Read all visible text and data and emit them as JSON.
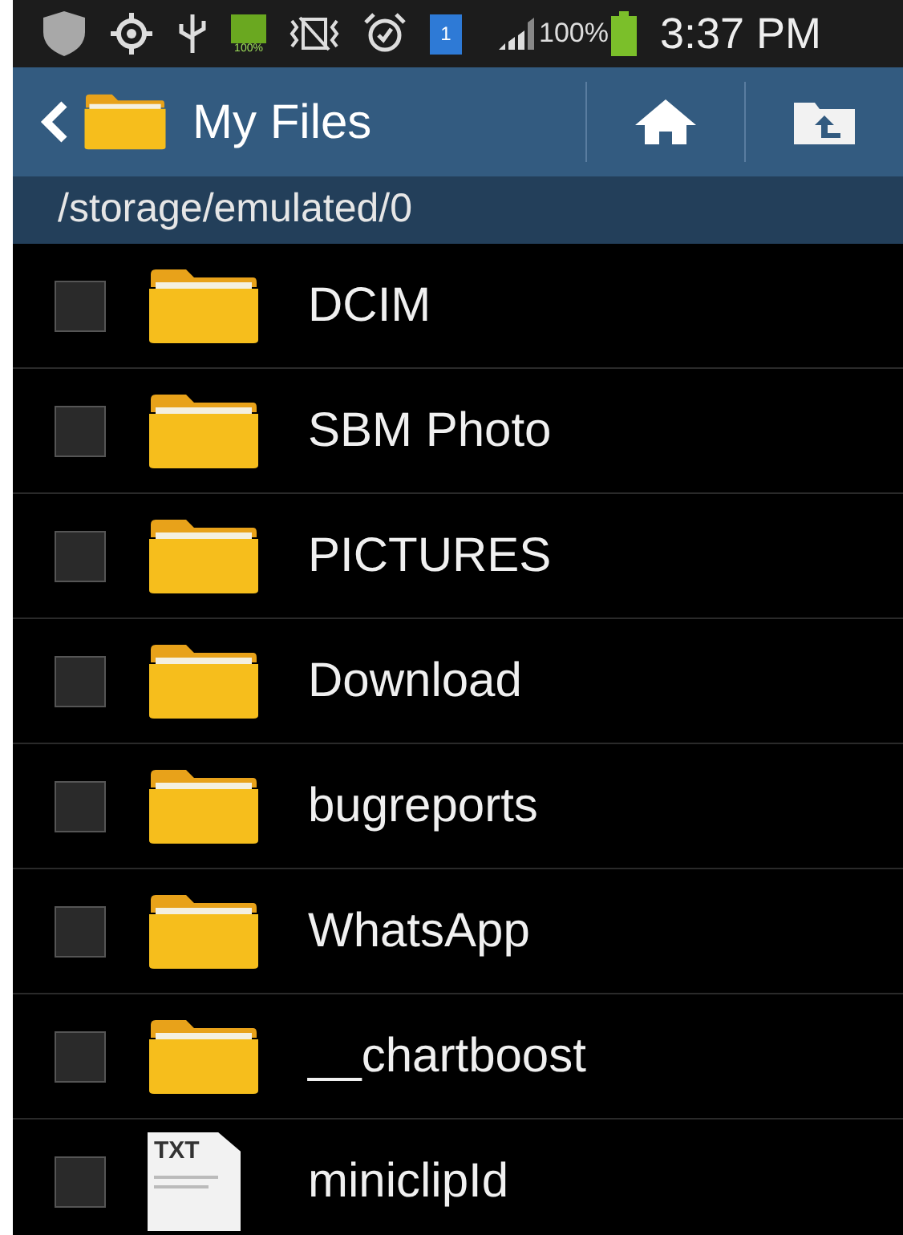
{
  "status_bar": {
    "battery_icon_label": "100%",
    "sim_badge": "1",
    "battery_percent": "100%",
    "time": "3:37 PM"
  },
  "action_bar": {
    "title": "My Files"
  },
  "path": "/storage/emulated/0",
  "items": [
    {
      "name": "DCIM",
      "kind": "folder",
      "checked": false
    },
    {
      "name": "SBM Photo",
      "kind": "folder",
      "checked": false
    },
    {
      "name": "PICTURES",
      "kind": "folder",
      "checked": false
    },
    {
      "name": "Download",
      "kind": "folder",
      "checked": false
    },
    {
      "name": "bugreports",
      "kind": "folder",
      "checked": false
    },
    {
      "name": "WhatsApp",
      "kind": "folder",
      "checked": false
    },
    {
      "name": "__chartboost",
      "kind": "folder",
      "checked": false
    },
    {
      "name": "miniclipId",
      "kind": "txt",
      "checked": false,
      "icon_label": "TXT"
    }
  ]
}
